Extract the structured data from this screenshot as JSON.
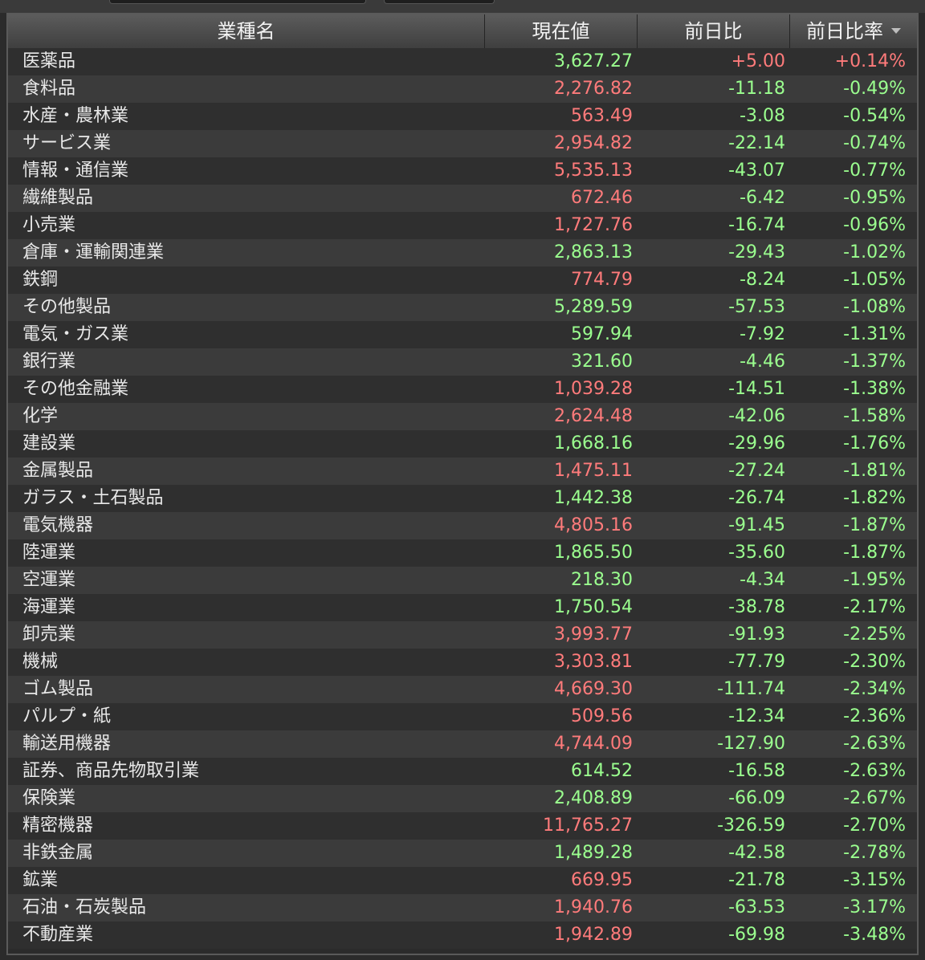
{
  "colors": {
    "gain": "#ff7b7b",
    "loss": "#9bff8f",
    "header_bg": "#4a4a4a",
    "row_bg": "#2f2f2f",
    "row_alt_bg": "#3b3b3b"
  },
  "table": {
    "headers": {
      "name": "業種名",
      "price": "現在値",
      "change": "前日比",
      "change_rate": "前日比率"
    },
    "sort_icon": "sort-descending-icon",
    "rows": [
      {
        "name": "医薬品",
        "price": "3,627.27",
        "price_dir": "down",
        "change": "+5.00",
        "change_rate": "+0.14%",
        "dir": "up"
      },
      {
        "name": "食料品",
        "price": "2,276.82",
        "price_dir": "up",
        "change": "-11.18",
        "change_rate": "-0.49%",
        "dir": "down"
      },
      {
        "name": "水産・農林業",
        "price": "563.49",
        "price_dir": "up",
        "change": "-3.08",
        "change_rate": "-0.54%",
        "dir": "down"
      },
      {
        "name": "サービス業",
        "price": "2,954.82",
        "price_dir": "up",
        "change": "-22.14",
        "change_rate": "-0.74%",
        "dir": "down"
      },
      {
        "name": "情報・通信業",
        "price": "5,535.13",
        "price_dir": "up",
        "change": "-43.07",
        "change_rate": "-0.77%",
        "dir": "down"
      },
      {
        "name": "繊維製品",
        "price": "672.46",
        "price_dir": "up",
        "change": "-6.42",
        "change_rate": "-0.95%",
        "dir": "down"
      },
      {
        "name": "小売業",
        "price": "1,727.76",
        "price_dir": "up",
        "change": "-16.74",
        "change_rate": "-0.96%",
        "dir": "down"
      },
      {
        "name": "倉庫・運輸関連業",
        "price": "2,863.13",
        "price_dir": "down",
        "change": "-29.43",
        "change_rate": "-1.02%",
        "dir": "down"
      },
      {
        "name": "鉄鋼",
        "price": "774.79",
        "price_dir": "up",
        "change": "-8.24",
        "change_rate": "-1.05%",
        "dir": "down"
      },
      {
        "name": "その他製品",
        "price": "5,289.59",
        "price_dir": "down",
        "change": "-57.53",
        "change_rate": "-1.08%",
        "dir": "down"
      },
      {
        "name": "電気・ガス業",
        "price": "597.94",
        "price_dir": "down",
        "change": "-7.92",
        "change_rate": "-1.31%",
        "dir": "down"
      },
      {
        "name": "銀行業",
        "price": "321.60",
        "price_dir": "down",
        "change": "-4.46",
        "change_rate": "-1.37%",
        "dir": "down"
      },
      {
        "name": "その他金融業",
        "price": "1,039.28",
        "price_dir": "up",
        "change": "-14.51",
        "change_rate": "-1.38%",
        "dir": "down"
      },
      {
        "name": "化学",
        "price": "2,624.48",
        "price_dir": "up",
        "change": "-42.06",
        "change_rate": "-1.58%",
        "dir": "down"
      },
      {
        "name": "建設業",
        "price": "1,668.16",
        "price_dir": "down",
        "change": "-29.96",
        "change_rate": "-1.76%",
        "dir": "down"
      },
      {
        "name": "金属製品",
        "price": "1,475.11",
        "price_dir": "up",
        "change": "-27.24",
        "change_rate": "-1.81%",
        "dir": "down"
      },
      {
        "name": "ガラス・土石製品",
        "price": "1,442.38",
        "price_dir": "down",
        "change": "-26.74",
        "change_rate": "-1.82%",
        "dir": "down"
      },
      {
        "name": "電気機器",
        "price": "4,805.16",
        "price_dir": "up",
        "change": "-91.45",
        "change_rate": "-1.87%",
        "dir": "down"
      },
      {
        "name": "陸運業",
        "price": "1,865.50",
        "price_dir": "down",
        "change": "-35.60",
        "change_rate": "-1.87%",
        "dir": "down"
      },
      {
        "name": "空運業",
        "price": "218.30",
        "price_dir": "down",
        "change": "-4.34",
        "change_rate": "-1.95%",
        "dir": "down"
      },
      {
        "name": "海運業",
        "price": "1,750.54",
        "price_dir": "down",
        "change": "-38.78",
        "change_rate": "-2.17%",
        "dir": "down"
      },
      {
        "name": "卸売業",
        "price": "3,993.77",
        "price_dir": "up",
        "change": "-91.93",
        "change_rate": "-2.25%",
        "dir": "down"
      },
      {
        "name": "機械",
        "price": "3,303.81",
        "price_dir": "up",
        "change": "-77.79",
        "change_rate": "-2.30%",
        "dir": "down"
      },
      {
        "name": "ゴム製品",
        "price": "4,669.30",
        "price_dir": "up",
        "change": "-111.74",
        "change_rate": "-2.34%",
        "dir": "down"
      },
      {
        "name": "パルプ・紙",
        "price": "509.56",
        "price_dir": "up",
        "change": "-12.34",
        "change_rate": "-2.36%",
        "dir": "down"
      },
      {
        "name": "輸送用機器",
        "price": "4,744.09",
        "price_dir": "up",
        "change": "-127.90",
        "change_rate": "-2.63%",
        "dir": "down"
      },
      {
        "name": "証券、商品先物取引業",
        "price": "614.52",
        "price_dir": "down",
        "change": "-16.58",
        "change_rate": "-2.63%",
        "dir": "down"
      },
      {
        "name": "保険業",
        "price": "2,408.89",
        "price_dir": "down",
        "change": "-66.09",
        "change_rate": "-2.67%",
        "dir": "down"
      },
      {
        "name": "精密機器",
        "price": "11,765.27",
        "price_dir": "up",
        "change": "-326.59",
        "change_rate": "-2.70%",
        "dir": "down"
      },
      {
        "name": "非鉄金属",
        "price": "1,489.28",
        "price_dir": "down",
        "change": "-42.58",
        "change_rate": "-2.78%",
        "dir": "down"
      },
      {
        "name": "鉱業",
        "price": "669.95",
        "price_dir": "up",
        "change": "-21.78",
        "change_rate": "-3.15%",
        "dir": "down"
      },
      {
        "name": "石油・石炭製品",
        "price": "1,940.76",
        "price_dir": "up",
        "change": "-63.53",
        "change_rate": "-3.17%",
        "dir": "down"
      },
      {
        "name": "不動産業",
        "price": "1,942.89",
        "price_dir": "up",
        "change": "-69.98",
        "change_rate": "-3.48%",
        "dir": "down"
      }
    ]
  }
}
